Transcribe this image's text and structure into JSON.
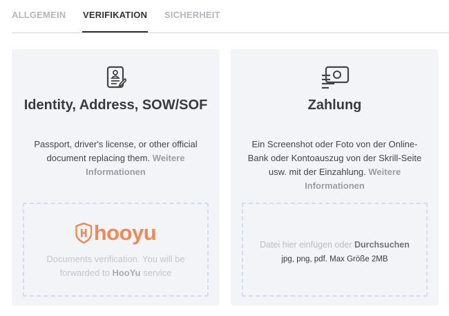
{
  "tabs": [
    {
      "label": "ALLGEMEIN",
      "active": false
    },
    {
      "label": "VERIFIKATION",
      "active": true
    },
    {
      "label": "SICHERHEIT",
      "active": false
    }
  ],
  "identity": {
    "icon": "id-document-icon",
    "title": "Identity, Address, SOW/SOF",
    "description": "Passport, driver's license, or other official document replacing them.",
    "more_link": "Weitere Informationen",
    "dropzone": {
      "logo_text": "hooyu",
      "text_before": "Documents verification. You will be forwarded to",
      "service_name": "HooYu",
      "text_after": "service"
    }
  },
  "payment": {
    "icon": "payment-document-icon",
    "title": "Zahlung",
    "description": "Ein Screenshot oder Foto von der Online-Bank oder Kontoauszug von der Skrill-Seite usw. mit der Einzahlung.",
    "more_link": "Weitere Informationen",
    "dropzone": {
      "paste_text": "Datei hier einfügen oder",
      "browse_link": "Durchsuchen",
      "formats": "jpg, png, pdf. Max Größe 2MB"
    }
  },
  "colors": {
    "accent_orange": "#ed8a57",
    "card_background": "#f3f4f8",
    "dropzone_border": "#d3ddef"
  }
}
